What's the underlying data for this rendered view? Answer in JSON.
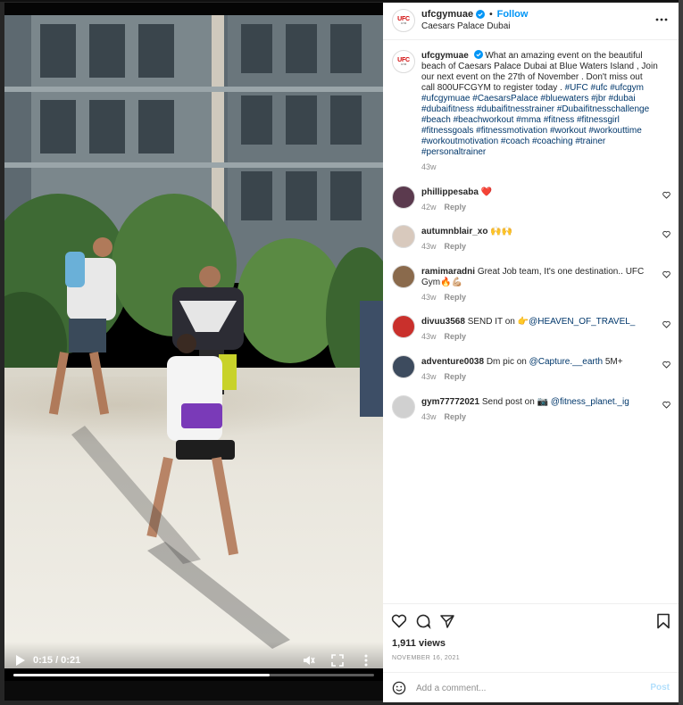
{
  "post": {
    "username": "ufcgymuae",
    "follow_label": "Follow",
    "separator": "•",
    "location": "Caesars Palace Dubai",
    "avatar_text": "UFC",
    "avatar_subtext": "GYM"
  },
  "video": {
    "time_display": "0:15 / 0:21",
    "progress": 0.71
  },
  "caption": {
    "username": "ufcgymuae",
    "text": "What an amazing event on the beautiful beach of Caesars Palace Dubai at Blue Waters Island , Join our next event on the 27th of November . Don't miss out call 800UFCGYM to register today . ",
    "hashtags": "#UFC #ufc #ufcgym #ufcgymuae #CaesarsPalace #bluewaters #jbr #dubai #dubaifitness #dubaifitnesstrainer #Dubaifitnesschallenge #beach #beachworkout #mma #fitness #fitnessgirl #fitnessgoals #fitnessmotivation #workout #workouttime #workoutmotivation #coach #coaching #trainer #personaltrainer",
    "age": "43w"
  },
  "comments": [
    {
      "username": "phillippesaba",
      "text": "",
      "emoji": "❤️",
      "mention": "",
      "age": "42w",
      "reply_label": "Reply",
      "avatar_color": "#5b3a4e"
    },
    {
      "username": "autumnblair_xo",
      "text": "",
      "emoji": "🙌🙌",
      "mention": "",
      "age": "43w",
      "reply_label": "Reply",
      "avatar_color": "#d8c9bd"
    },
    {
      "username": "ramimaradni",
      "text": "Great Job team, It's one destination.. UFC Gym",
      "emoji": "🔥💪🏼",
      "mention": "",
      "age": "43w",
      "reply_label": "Reply",
      "avatar_color": "#8a6a4c"
    },
    {
      "username": "divuu3568",
      "text": "SEND IT on",
      "emoji": "👉",
      "mention": "@HEAVEN_OF_TRAVEL_",
      "age": "43w",
      "reply_label": "Reply",
      "avatar_color": "#c9302c"
    },
    {
      "username": "adventure0038",
      "text": "Dm pic on",
      "emoji": "",
      "mention": "@Capture.__earth",
      "suffix": " 5M+",
      "age": "43w",
      "reply_label": "Reply",
      "avatar_color": "#3d4b5e"
    },
    {
      "username": "gym77772021",
      "text": "Send post on",
      "emoji": "📷",
      "mention": "@fitness_planet._ig",
      "age": "43w",
      "reply_label": "Reply",
      "avatar_color": "#d0d0d0"
    }
  ],
  "stats": {
    "views": "1,911 views",
    "date": "NOVEMBER 16, 2021"
  },
  "add_comment": {
    "placeholder": "Add a comment...",
    "post_label": "Post"
  },
  "colors": {
    "accent": "#0095f6",
    "hashtag": "#00376b",
    "muted": "#8e8e8e"
  }
}
